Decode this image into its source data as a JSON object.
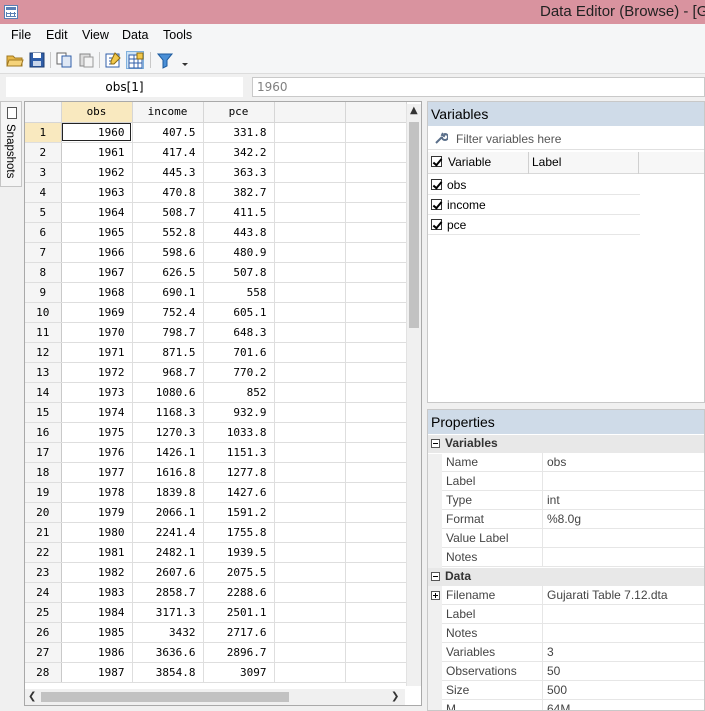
{
  "window": {
    "title": "Data Editor (Browse) - [G"
  },
  "menu": [
    "File",
    "Edit",
    "View",
    "Data",
    "Tools"
  ],
  "cell": {
    "name": "obs[1]",
    "value": "1960"
  },
  "snapshots": {
    "label": "Snapshots"
  },
  "grid": {
    "columns": [
      "obs",
      "income",
      "pce"
    ],
    "rows": [
      [
        "1960",
        "407.5",
        "331.8"
      ],
      [
        "1961",
        "417.4",
        "342.2"
      ],
      [
        "1962",
        "445.3",
        "363.3"
      ],
      [
        "1963",
        "470.8",
        "382.7"
      ],
      [
        "1964",
        "508.7",
        "411.5"
      ],
      [
        "1965",
        "552.8",
        "443.8"
      ],
      [
        "1966",
        "598.6",
        "480.9"
      ],
      [
        "1967",
        "626.5",
        "507.8"
      ],
      [
        "1968",
        "690.1",
        "558"
      ],
      [
        "1969",
        "752.4",
        "605.1"
      ],
      [
        "1970",
        "798.7",
        "648.3"
      ],
      [
        "1971",
        "871.5",
        "701.6"
      ],
      [
        "1972",
        "968.7",
        "770.2"
      ],
      [
        "1973",
        "1080.6",
        "852"
      ],
      [
        "1974",
        "1168.3",
        "932.9"
      ],
      [
        "1975",
        "1270.3",
        "1033.8"
      ],
      [
        "1976",
        "1426.1",
        "1151.3"
      ],
      [
        "1977",
        "1616.8",
        "1277.8"
      ],
      [
        "1978",
        "1839.8",
        "1427.6"
      ],
      [
        "1979",
        "2066.1",
        "1591.2"
      ],
      [
        "1980",
        "2241.4",
        "1755.8"
      ],
      [
        "1981",
        "2482.1",
        "1939.5"
      ],
      [
        "1982",
        "2607.6",
        "2075.5"
      ],
      [
        "1983",
        "2858.7",
        "2288.6"
      ],
      [
        "1984",
        "3171.3",
        "2501.1"
      ],
      [
        "1985",
        "3432",
        "2717.6"
      ],
      [
        "1986",
        "3636.6",
        "2896.7"
      ],
      [
        "1987",
        "3854.8",
        "3097"
      ]
    ]
  },
  "variables_panel": {
    "title": "Variables",
    "filter_placeholder": "Filter variables here",
    "col_variable": "Variable",
    "col_label": "Label",
    "items": [
      "obs",
      "income",
      "pce"
    ]
  },
  "properties_panel": {
    "title": "Properties",
    "sections": [
      {
        "name": "Variables",
        "rows": [
          {
            "k": "Name",
            "v": "obs"
          },
          {
            "k": "Label",
            "v": ""
          },
          {
            "k": "Type",
            "v": "int"
          },
          {
            "k": "Format",
            "v": "%8.0g"
          },
          {
            "k": "Value Label",
            "v": ""
          },
          {
            "k": "Notes",
            "v": ""
          }
        ]
      },
      {
        "name": "Data",
        "rows": [
          {
            "k": "Filename",
            "v": "Gujarati Table 7.12.dta",
            "expandable": true
          },
          {
            "k": "Label",
            "v": ""
          },
          {
            "k": "Notes",
            "v": ""
          },
          {
            "k": "Variables",
            "v": "3"
          },
          {
            "k": "Observations",
            "v": "50"
          },
          {
            "k": "Size",
            "v": "500"
          },
          {
            "k": "M",
            "v": "64M"
          }
        ]
      }
    ]
  },
  "colors": {
    "titlebar": "#d9939f",
    "panel_header": "#cfdbe8",
    "selected_header": "#f9e9bf"
  }
}
